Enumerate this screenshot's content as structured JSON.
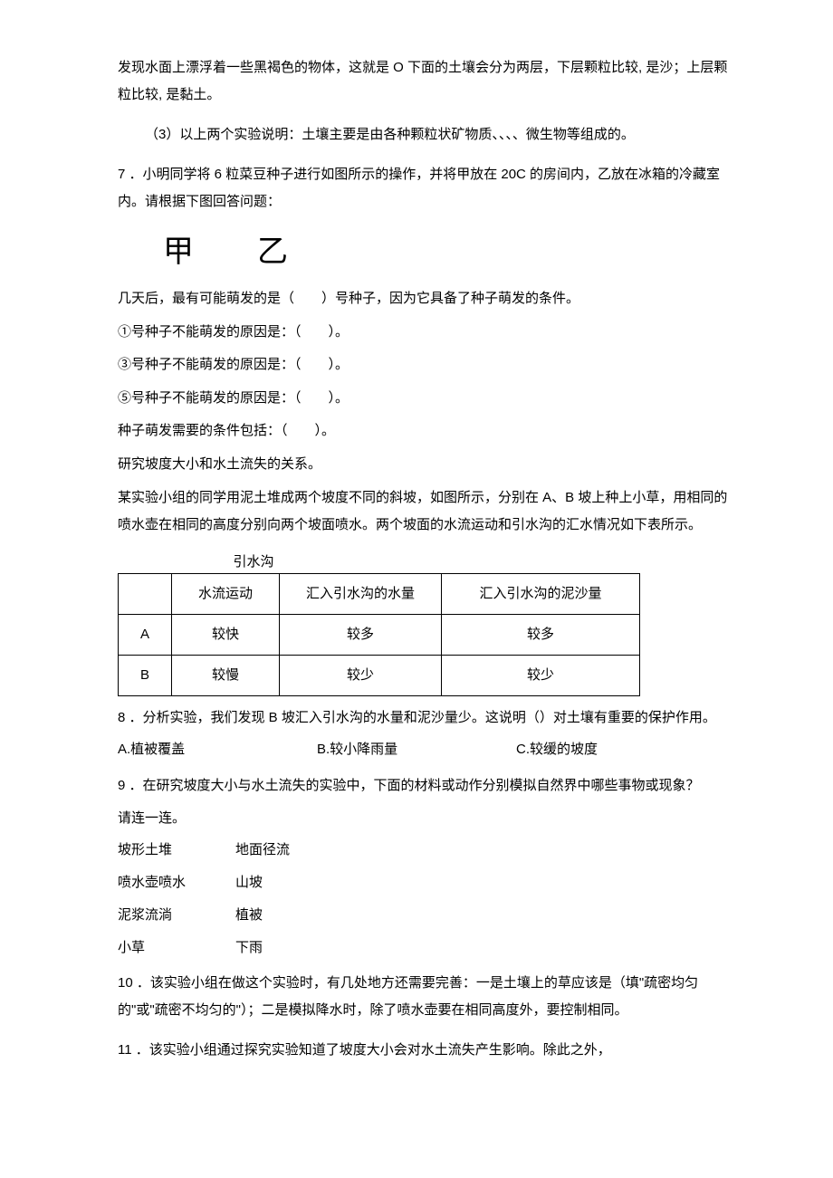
{
  "p1": "发现水面上漂浮着一些黑褐色的物体，这就是 O 下面的土壤会分为两层，下层颗粒比较, 是沙；上层颗粒比较, 是黏土。",
  "p2": "（3）以上两个实验说明：土壤主要是由各种颗粒状矿物质、、、、微生物等组成的。",
  "p3": "7 ．小明同学将 6 粒菜豆种子进行如图所示的操作，并将甲放在 20C 的房间内，乙放在冰箱的冷藏室内。请根据下图回答问题：",
  "chars": "甲乙",
  "p4": "几天后，最有可能萌发的是（　　）号种子，因为它具备了种子萌发的条件。",
  "p5": "①号种子不能萌发的原因是：（　　）。",
  "p6": "③号种子不能萌发的原因是：（　　）。",
  "p7": "⑤号种子不能萌发的原因是：（　　）。",
  "p8": "种子萌发需要的条件包括：（　　）。",
  "p9": "研究坡度大小和水土流失的关系。",
  "p10": "某实验小组的同学用泥土堆成两个坡度不同的斜坡，如图所示，分别在 A、B 坡上种上小草，用相同的喷水壶在相同的高度分别向两个坡面喷水。两个坡面的水流运动和引水沟的汇水情况如下表所示。",
  "gou": "引水沟",
  "table": {
    "head": [
      "",
      "水流运动",
      "汇入引水沟的水量",
      "汇入引水沟的泥沙量"
    ],
    "rows": [
      [
        "A",
        "较快",
        "较多",
        "较多"
      ],
      [
        "B",
        "较慢",
        "较少",
        "较少"
      ]
    ]
  },
  "q8": "8 ．分析实验，我们发现 B 坡汇入引水沟的水量和泥沙量少。这说明（）对土壤有重要的保护作用。",
  "opts": {
    "a": "A.植被覆盖",
    "b": "B.较小降雨量",
    "c": "C.较缓的坡度"
  },
  "q9a": "9 ．在研究坡度大小与水土流失的实验中，下面的材料或动作分别模拟自然界中哪些事物或现象？",
  "q9b": "请连一连。",
  "match": [
    {
      "l": "坡形土堆",
      "r": "地面径流"
    },
    {
      "l": "喷水壶喷水",
      "r": "山坡"
    },
    {
      "l": "泥浆流淌",
      "r": "植被"
    },
    {
      "l": "小草",
      "r": "下雨"
    }
  ],
  "q10": "10 ．该实验小组在做这个实验时，有几处地方还需要完善：一是土壤上的草应该是（填\"疏密均匀的\"或\"疏密不均匀的\"）；二是模拟降水时，除了喷水壶要在相同高度外，要控制相同。",
  "q11": "11 ．该实验小组通过探究实验知道了坡度大小会对水土流失产生影响。除此之外，"
}
